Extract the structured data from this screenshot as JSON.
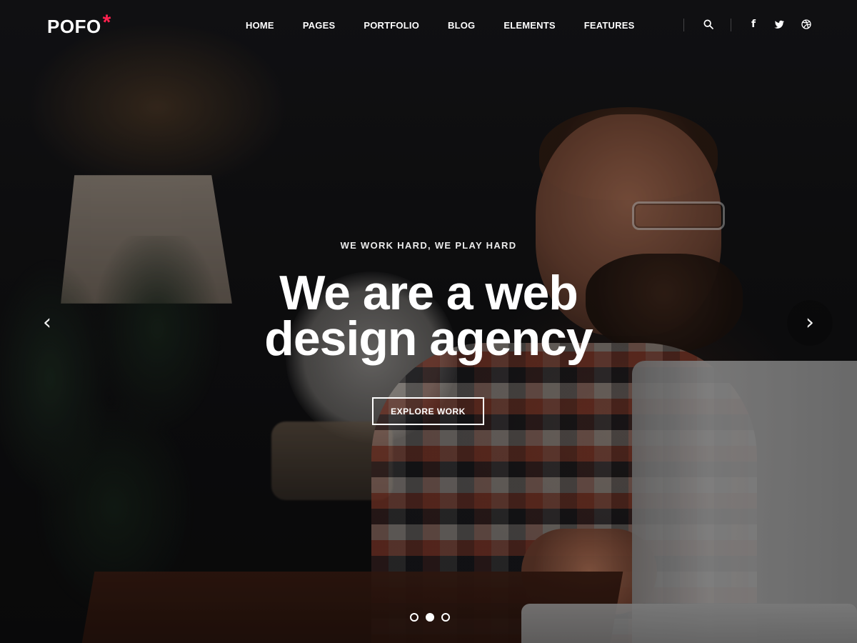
{
  "header": {
    "logo_text": "POFO",
    "logo_mark": "*",
    "nav": [
      {
        "label": "HOME"
      },
      {
        "label": "PAGES"
      },
      {
        "label": "PORTFOLIO"
      },
      {
        "label": "BLOG"
      },
      {
        "label": "ELEMENTS"
      },
      {
        "label": "FEATURES"
      }
    ],
    "actions": {
      "search_icon": "search-icon",
      "social_icons": [
        "facebook-icon",
        "twitter-icon",
        "dribbble-icon"
      ]
    }
  },
  "hero": {
    "kicker": "WE WORK HARD, WE PLAY HARD",
    "headline_line1": "We are a web",
    "headline_line2": "design agency",
    "cta_label": "EXPLORE WORK",
    "slider": {
      "dots_count": 3,
      "active_index": 1
    }
  },
  "colors": {
    "accent": "#ff214f",
    "text": "#ffffff"
  }
}
